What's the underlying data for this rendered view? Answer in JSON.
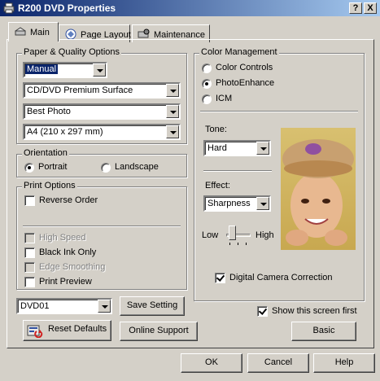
{
  "window": {
    "title": "R200 DVD Properties",
    "help_btn": "?",
    "close_btn": "X"
  },
  "tabs": [
    {
      "label": "Main",
      "icon": "printer-main-icon"
    },
    {
      "label": "Page Layout",
      "icon": "page-layout-icon"
    },
    {
      "label": "Maintenance",
      "icon": "maintenance-icon"
    }
  ],
  "paper_quality": {
    "title": "Paper & Quality Options",
    "mode": "Manual",
    "media_type": "CD/DVD Premium Surface",
    "quality": "Best Photo",
    "size": "A4 (210 x 297 mm)"
  },
  "orientation": {
    "title": "Orientation",
    "portrait": "Portrait",
    "landscape": "Landscape",
    "selected": "Portrait"
  },
  "print_options": {
    "title": "Print Options",
    "reverse_order": "Reverse Order",
    "high_speed": "High Speed",
    "black_ink_only": "Black Ink Only",
    "edge_smoothing": "Edge Smoothing",
    "print_preview": "Print Preview"
  },
  "settings": {
    "saved": "DVD01",
    "save_setting": "Save Setting",
    "reset_defaults": "Reset Defaults",
    "online_support": "Online Support"
  },
  "color_management": {
    "title": "Color Management",
    "color_controls": "Color Controls",
    "photo_enhance": "PhotoEnhance",
    "icm": "ICM",
    "selected": "PhotoEnhance",
    "tone_label": "Tone:",
    "tone_value": "Hard",
    "effect_label": "Effect:",
    "effect_value": "Sharpness",
    "slider_low": "Low",
    "slider_high": "High",
    "slider_level": 0.15,
    "digital_camera_correction": "Digital Camera Correction",
    "digital_camera_checked": true
  },
  "show_screen_first": {
    "label": "Show this screen first",
    "checked": true
  },
  "basic_button": "Basic",
  "footer": {
    "ok": "OK",
    "cancel": "Cancel",
    "help": "Help"
  },
  "colors": {
    "title_start": "#0a246a",
    "title_end": "#a6caf0",
    "face": "#d4d0c8"
  }
}
